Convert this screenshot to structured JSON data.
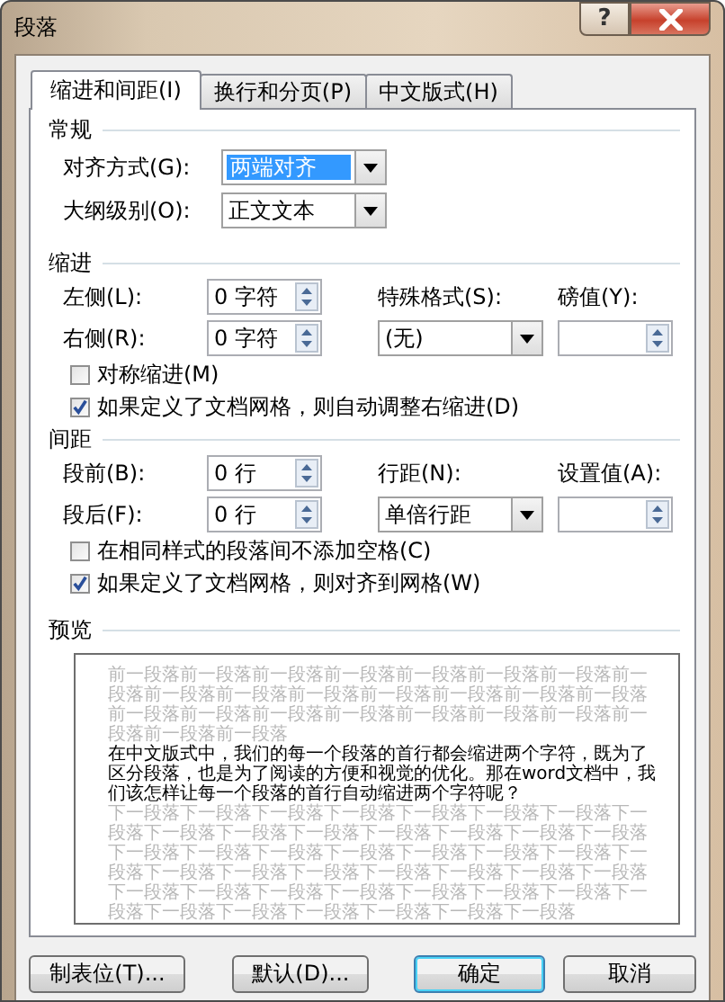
{
  "window": {
    "title": "段落",
    "help": "?"
  },
  "tabs": [
    {
      "label": "缩进和间距(I)",
      "selected": true
    },
    {
      "label": "换行和分页(P)",
      "selected": false
    },
    {
      "label": "中文版式(H)",
      "selected": false
    }
  ],
  "general": {
    "heading": "常规",
    "fields": [
      {
        "label": "对齐方式(G):",
        "value": "两端对齐",
        "highlighted": true
      },
      {
        "label": "大纲级别(O):",
        "value": "正文文本",
        "highlighted": false
      }
    ]
  },
  "indent": {
    "heading": "缩进",
    "left": {
      "label": "左侧(L):",
      "value": "0 字符"
    },
    "right": {
      "label": "右侧(R):",
      "value": "0 字符"
    },
    "special": {
      "label": "特殊格式(S):",
      "value": "(无)"
    },
    "by": {
      "label": "磅值(Y):"
    },
    "checkboxes": [
      {
        "label": "对称缩进(M)",
        "checked": false
      },
      {
        "label": "如果定义了文档网格，则自动调整右缩进(D)",
        "checked": true
      }
    ]
  },
  "spacing": {
    "heading": "间距",
    "before": {
      "label": "段前(B):",
      "value": "0 行"
    },
    "after": {
      "label": "段后(F):",
      "value": "0 行"
    },
    "line": {
      "label": "行距(N):",
      "value": "单倍行距"
    },
    "at": {
      "label": "设置值(A):"
    },
    "checkboxes": [
      {
        "label": "在相同样式的段落间不添加空格(C)",
        "checked": false
      },
      {
        "label": "如果定义了文档网格，则对齐到网格(W)",
        "checked": true
      }
    ]
  },
  "preview": {
    "heading": "预览",
    "before": "前一段落前一段落前一段落前一段落前一段落前一段落前一段落前一段落前一段落前一段落前一段落前一段落前一段落前一段落前一段落前一段落前一段落前一段落前一段落前一段落前一段落前一段落前一段落前一段落前一段落",
    "main": "在中文版式中，我们的每一个段落的首行都会缩进两个字符，既为了区分段落，也是为了阅读的方便和视觉的优化。那在word文档中，我们该怎样让每一个段落的首行自动缩进两个字符呢？",
    "after": "下一段落下一段落下一段落下一段落下一段落下一段落下一段落下一段落下一段落下一段落下一段落下一段落下一段落下一段落下一段落下一段落下一段落下一段落下一段落下一段落下一段落下一段落下一段落下一段落下一段落下一段落下一段落下一段落下一段落下一段落下一段落下一段落下一段落下一段落下一段落下一段落下一段落下一段落下一段落下一段落下一段落下一段落下一段落下一段落"
  },
  "buttons": [
    {
      "label": "制表位(T)...",
      "kind": "normal"
    },
    {
      "label": "默认(D)...",
      "kind": "normal"
    },
    {
      "label": "确定",
      "kind": "default"
    },
    {
      "label": "取消",
      "kind": "normal"
    }
  ]
}
